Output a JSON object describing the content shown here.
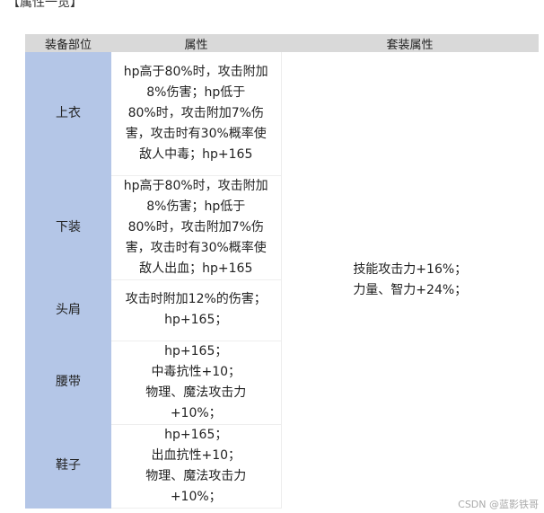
{
  "heading": "【属性一览】",
  "table": {
    "headers": [
      "装备部位",
      "属性",
      "套装属性"
    ],
    "rows": [
      {
        "slot": "上衣",
        "lines": [
          "hp高于80%时，攻击附加",
          "8%伤害；hp低于",
          "80%时，攻击附加7%伤",
          "害，攻击时有30%概率使",
          "敌人中毒；hp+165"
        ]
      },
      {
        "slot": "下装",
        "lines": [
          "hp高于80%时，攻击附加",
          "8%伤害；hp低于",
          "80%时，攻击附加7%伤",
          "害，攻击时有30%概率使",
          "敌人出血；hp+165"
        ]
      },
      {
        "slot": "头肩",
        "lines": [
          "攻击时附加12%的伤害；",
          "hp+165；"
        ]
      },
      {
        "slot": "腰带",
        "lines": [
          "hp+165；",
          "中毒抗性+10；",
          "物理、魔法攻击力",
          "+10%；"
        ]
      },
      {
        "slot": "鞋子",
        "lines": [
          "hp+165；",
          "出血抗性+10；",
          "物理、魔法攻击力",
          "+10%；"
        ]
      }
    ],
    "set_attribute": [
      "技能攻击力+16%；",
      "力量、智力+24%；"
    ]
  },
  "watermark": "CSDN @蓝影铁哥"
}
